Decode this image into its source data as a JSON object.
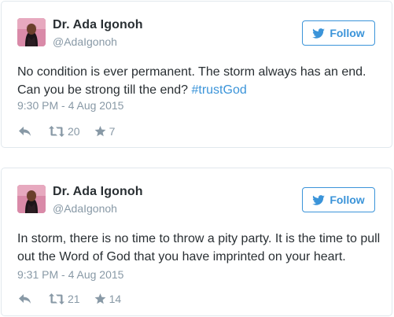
{
  "tweets": [
    {
      "author_name": "Dr. Ada Igonoh",
      "handle": "@AdaIgonoh",
      "follow_label": "Follow",
      "text_main": "No condition is ever permanent. The storm always has an end. Can you be strong till the end? ",
      "hashtag": "#trustGod",
      "timestamp": "9:30 PM - 4 Aug 2015",
      "retweets": "20",
      "favorites": "7"
    },
    {
      "author_name": "Dr. Ada Igonoh",
      "handle": "@AdaIgonoh",
      "follow_label": "Follow",
      "text_main": "In storm, there is no time to throw a pity party. It is the time to pull out the Word of God that you have imprinted on your heart.",
      "hashtag": "",
      "timestamp": "9:31 PM - 4 Aug 2015",
      "retweets": "21",
      "favorites": "14"
    }
  ],
  "colors": {
    "accent": "#3b94d9",
    "text": "#292f33",
    "muted": "#8899a6",
    "border": "#e1e8ed"
  },
  "icons": {
    "follow": "bird-icon",
    "reply": "reply-icon",
    "retweet": "retweet-icon",
    "favorite": "star-icon"
  }
}
